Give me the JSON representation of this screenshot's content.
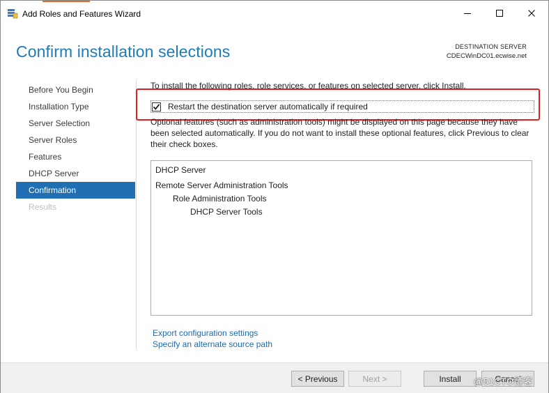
{
  "window": {
    "title": "Add Roles and Features Wizard",
    "accent_color": "#e86d2c"
  },
  "header": {
    "page_title": "Confirm installation selections",
    "destination_label": "DESTINATION SERVER",
    "destination_server": "CDECWinDC01.ecwise.net"
  },
  "nav": {
    "items": [
      {
        "label": "Before You Begin",
        "state": "normal"
      },
      {
        "label": "Installation Type",
        "state": "normal"
      },
      {
        "label": "Server Selection",
        "state": "normal"
      },
      {
        "label": "Server Roles",
        "state": "normal"
      },
      {
        "label": "Features",
        "state": "normal"
      },
      {
        "label": "DHCP Server",
        "state": "normal"
      },
      {
        "label": "Confirmation",
        "state": "active"
      },
      {
        "label": "Results",
        "state": "disabled"
      }
    ],
    "active_color": "#1f6fb2"
  },
  "main": {
    "intro": "To install the following roles, role services, or features on selected server, click Install.",
    "restart_label": "Restart the destination server automatically if required",
    "restart_checked": true,
    "optional_note": "Optional features (such as administration tools) might be displayed on this page because they have been selected automatically. If you do not want to install these optional features, click Previous to clear their check boxes.",
    "features": [
      {
        "label": "DHCP Server",
        "level": 0
      },
      {
        "label": "Remote Server Administration Tools",
        "level": 0
      },
      {
        "label": "Role Administration Tools",
        "level": 1
      },
      {
        "label": "DHCP Server Tools",
        "level": 2
      }
    ],
    "export_link": "Export configuration settings",
    "alternate_link": "Specify an alternate source path",
    "highlight_color": "#e02020"
  },
  "footer": {
    "previous_label": "< Previous",
    "next_label": "Next >",
    "install_label": "Install",
    "cancel_label": "Cancel"
  },
  "watermark": "@51CTO博客"
}
